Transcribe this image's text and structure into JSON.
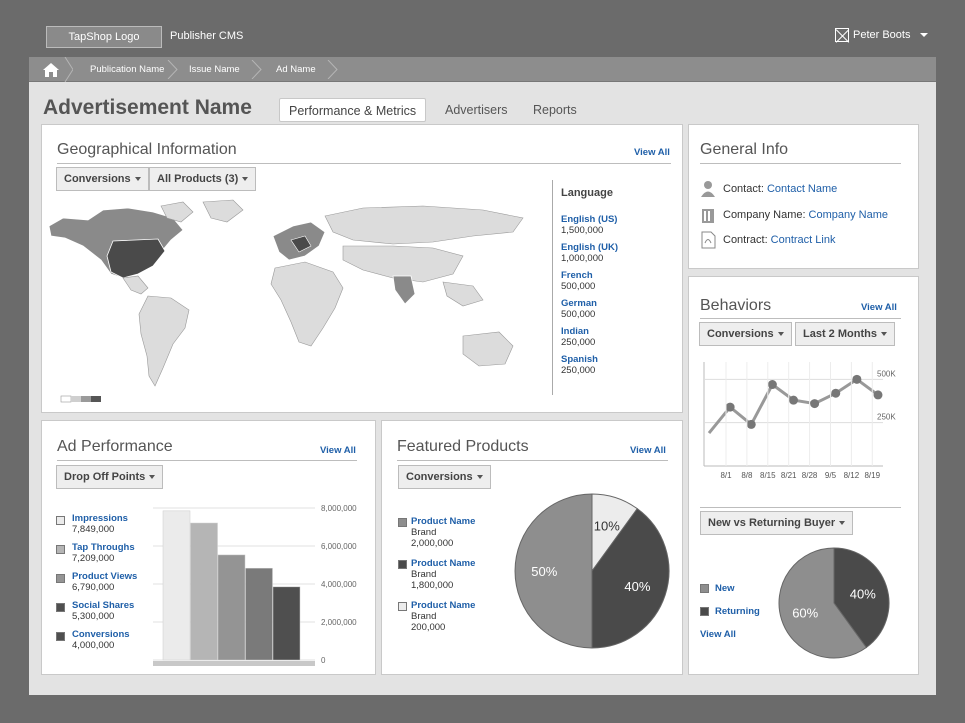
{
  "header": {
    "logo": "TapShop Logo",
    "app_name": "Publisher CMS",
    "user_name": "Peter Boots"
  },
  "breadcrumb": [
    "Publication Name",
    "Issue Name",
    "Ad Name"
  ],
  "page_title": "Advertisement Name",
  "tabs": [
    "Performance & Metrics",
    "Advertisers",
    "Reports"
  ],
  "geo": {
    "title": "Geographical Information",
    "view_all": "View All",
    "filter1": "Conversions",
    "filter2": "All Products (3)",
    "language_title": "Language",
    "languages": [
      {
        "name": "English (US)",
        "value": "1,500,000"
      },
      {
        "name": "English (UK)",
        "value": "1,000,000"
      },
      {
        "name": "French",
        "value": "500,000"
      },
      {
        "name": "German",
        "value": "500,000"
      },
      {
        "name": "Indian",
        "value": "250,000"
      },
      {
        "name": "Spanish",
        "value": "250,000"
      }
    ]
  },
  "general": {
    "title": "General Info",
    "contact_label": "Contact:",
    "contact_value": "Contact Name",
    "company_label": "Company Name:",
    "company_value": "Company Name",
    "contract_label": "Contract:",
    "contract_value": "Contract Link"
  },
  "behaviors": {
    "title": "Behaviors",
    "view_all": "View All",
    "filter1": "Conversions",
    "filter2": "Last 2 Months",
    "buyer_filter": "New vs Returning Buyer",
    "pie_legend": [
      "New",
      "Returning"
    ],
    "pie_view_all": "View All"
  },
  "ad_perf": {
    "title": "Ad Performance",
    "view_all": "View All",
    "filter": "Drop Off Points",
    "legend": [
      {
        "name": "Impressions",
        "value": "7,849,000"
      },
      {
        "name": "Tap Throughs",
        "value": "7,209,000"
      },
      {
        "name": "Product Views",
        "value": "6,790,000"
      },
      {
        "name": "Social Shares",
        "value": "5,300,000"
      },
      {
        "name": "Conversions",
        "value": "4,000,000"
      }
    ]
  },
  "featured": {
    "title": "Featured Products",
    "view_all": "View All",
    "filter": "Conversions",
    "products": [
      {
        "name": "Product Name",
        "brand": "Brand",
        "value": "2,000,000"
      },
      {
        "name": "Product Name",
        "brand": "Brand",
        "value": "1,800,000"
      },
      {
        "name": "Product Name",
        "brand": "Brand",
        "value": "200,000"
      }
    ]
  },
  "colors": {
    "link": "#1f5fa8",
    "frame": "#e3e3e3",
    "outer": "#6b6b6b"
  },
  "chart_data": [
    {
      "type": "line",
      "x": [
        "8/1",
        "8/8",
        "8/15",
        "8/21",
        "8/28",
        "9/5",
        "8/12",
        "8/19"
      ],
      "y_tick_labels": [
        "500K",
        "250K"
      ],
      "series": [
        {
          "values": [
            190,
            340,
            240,
            470,
            380,
            360,
            420,
            500,
            410
          ]
        }
      ]
    },
    {
      "type": "pie",
      "slices": [
        {
          "label": "New",
          "value": 60,
          "color": "#8e8e8e"
        },
        {
          "label": "Returning",
          "value": 40,
          "color": "#4a4a4a"
        }
      ]
    },
    {
      "type": "bar",
      "categories": [
        "Impressions",
        "Tap Throughs",
        "Product Views",
        "Social Shares",
        "Conversions"
      ],
      "values": [
        7849000,
        7209000,
        5530000,
        4830000,
        3850000
      ],
      "colors": [
        "#ebebeb",
        "#b5b5b5",
        "#949494",
        "#7a7a7a",
        "#4f4f4f"
      ],
      "y_ticks": [
        "8,000,000",
        "6,000,000",
        "4,000,000",
        "2,000,000",
        "0"
      ],
      "ylim": [
        0,
        8000000
      ]
    },
    {
      "type": "pie",
      "slices": [
        {
          "label": "Product Name",
          "value": 50,
          "color": "#8e8e8e"
        },
        {
          "label": "Product Name",
          "value": 40,
          "color": "#4a4a4a"
        },
        {
          "label": "Product Name",
          "value": 10,
          "color": "#ececec"
        }
      ]
    }
  ]
}
